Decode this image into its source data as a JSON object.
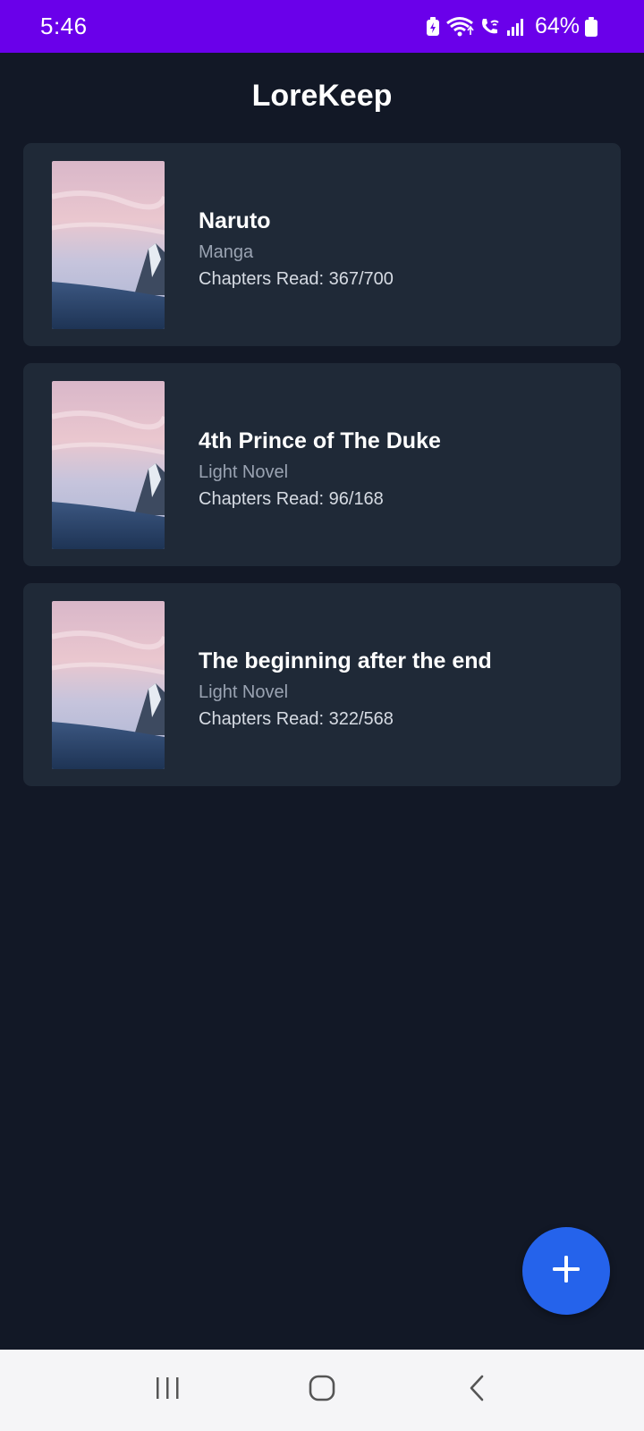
{
  "status_bar": {
    "time": "5:46",
    "battery": "64%",
    "icons": [
      "battery-saver-icon",
      "wifi-icon",
      "wifi-calling-icon",
      "signal-icon",
      "battery-icon"
    ]
  },
  "app": {
    "title": "LoreKeep"
  },
  "books": [
    {
      "title": "Naruto",
      "type": "Manga",
      "progress": "Chapters Read: 367/700"
    },
    {
      "title": "4th Prince of The Duke",
      "type": "Light Novel",
      "progress": "Chapters Read: 96/168"
    },
    {
      "title": "The beginning after the end",
      "type": "Light Novel",
      "progress": "Chapters Read: 322/568"
    }
  ],
  "fab": {
    "icon": "plus-icon"
  },
  "nav": {
    "icons": [
      "recent-apps-icon",
      "home-icon",
      "back-icon"
    ]
  },
  "colors": {
    "status_bar": "#6a00ea",
    "background": "#121826",
    "card": "#1f2937",
    "accent": "#2563eb"
  }
}
